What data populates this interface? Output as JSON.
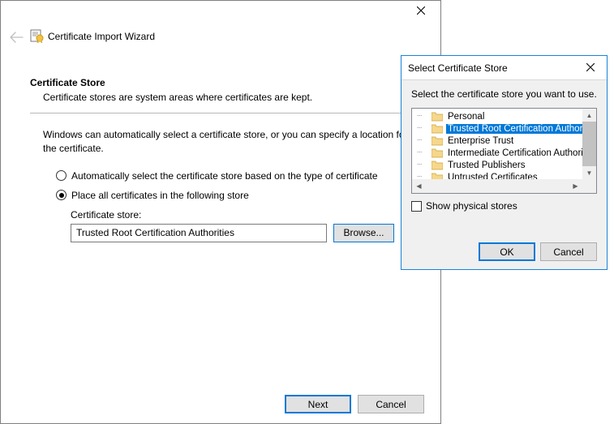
{
  "wizard": {
    "title": "Certificate Import Wizard",
    "heading": "Certificate Store",
    "subheading": "Certificate stores are system areas where certificates are kept.",
    "body_text": "Windows can automatically select a certificate store, or you can specify a location for the certificate.",
    "radio_auto": "Automatically select the certificate store based on the type of certificate",
    "radio_place": "Place all certificates in the following store",
    "store_label": "Certificate store:",
    "store_value": "Trusted Root Certification Authorities",
    "browse_label": "Browse...",
    "next_label": "Next",
    "cancel_label": "Cancel"
  },
  "dialog": {
    "title": "Select Certificate Store",
    "instruction": "Select the certificate store you want to use.",
    "tree": [
      {
        "label": "Personal",
        "selected": false
      },
      {
        "label": "Trusted Root Certification Authorities",
        "selected": true
      },
      {
        "label": "Enterprise Trust",
        "selected": false
      },
      {
        "label": "Intermediate Certification Authorities",
        "selected": false
      },
      {
        "label": "Trusted Publishers",
        "selected": false
      },
      {
        "label": "Untrusted Certificates",
        "selected": false
      }
    ],
    "show_physical": "Show physical stores",
    "ok_label": "OK",
    "cancel_label": "Cancel"
  }
}
